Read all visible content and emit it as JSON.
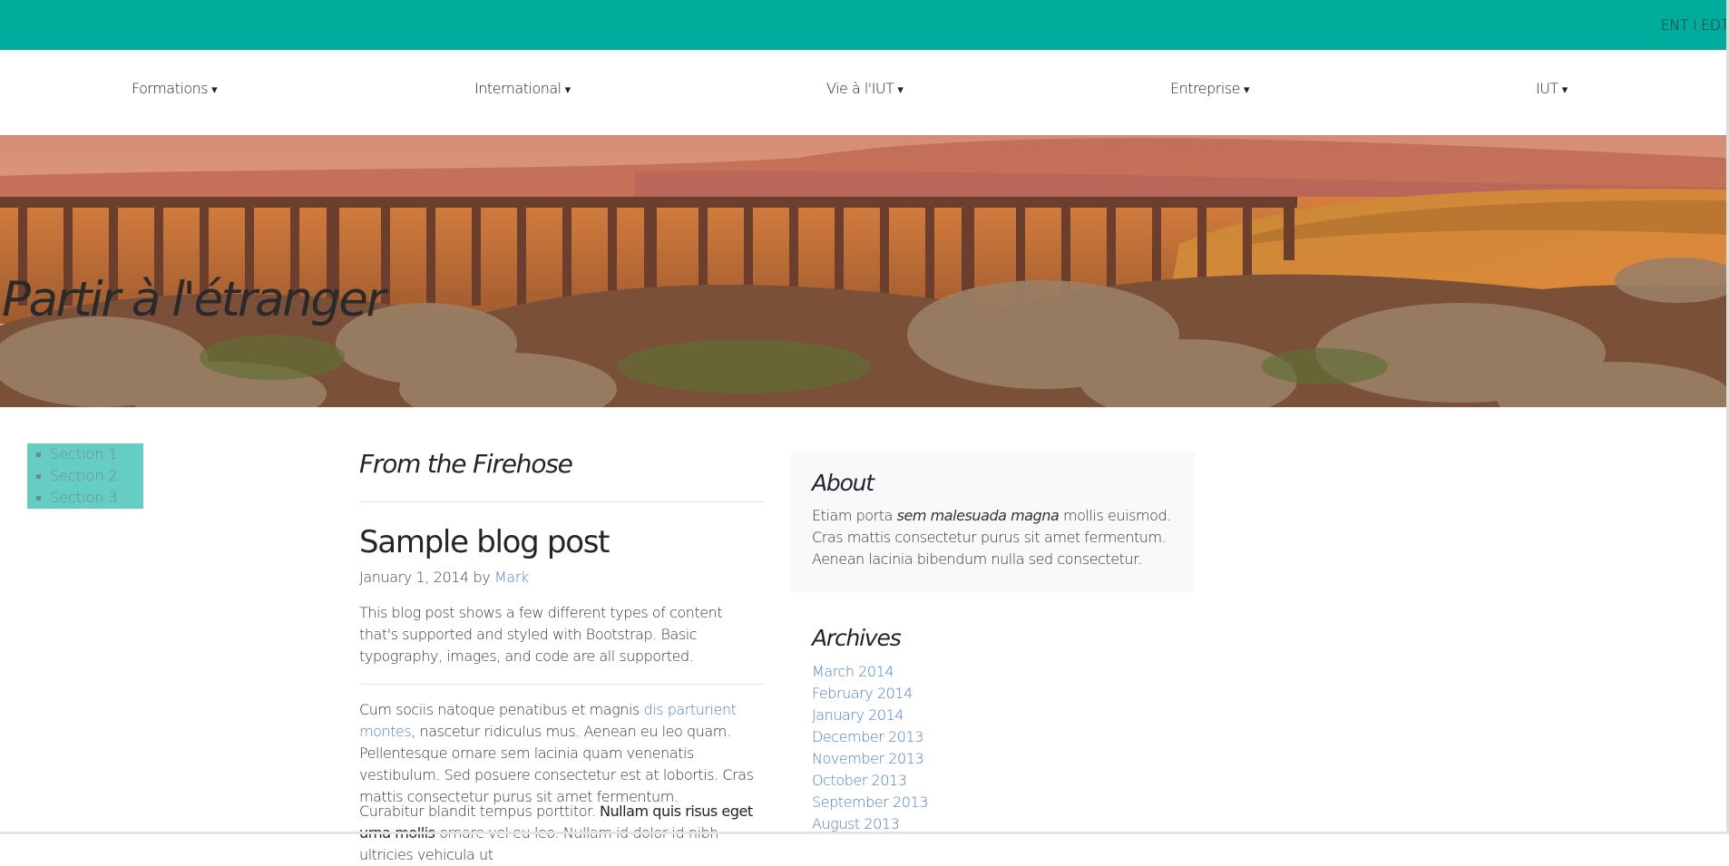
{
  "utility": {
    "links": [
      "ENT",
      "EDT"
    ],
    "separator": "I"
  },
  "nav": {
    "items": [
      {
        "label": "Formations",
        "caret": "▾"
      },
      {
        "label": "International",
        "caret": "▾"
      },
      {
        "label": "Vie à l'IUT",
        "caret": "▾"
      },
      {
        "label": "Entreprise",
        "caret": "▾"
      },
      {
        "label": "IUT",
        "caret": "▾"
      }
    ]
  },
  "hero": {
    "title": "Partir à l'étranger"
  },
  "section_nav": {
    "items": [
      "Section 1",
      "Section 2",
      "Section 3"
    ]
  },
  "main": {
    "heading": "From the Firehose",
    "post": {
      "title": "Sample blog post",
      "date": "January 1, 2014",
      "by": "by",
      "author": "Mark",
      "intro": "This blog post shows a few different types of content that's supported and styled with Bootstrap. Basic typography, images, and code are all supported.",
      "p1_before": "Cum sociis natoque penatibus et magnis ",
      "p1_link": "dis parturient montes",
      "p1_after": ", nascetur ridiculus mus. Aenean eu leo quam. Pellentesque ornare sem lacinia quam venenatis vestibulum. Sed posuere consectetur est at lobortis. Cras mattis consectetur purus sit amet fermentum.",
      "p2_before": "Curabitur blandit tempus porttitor. ",
      "p2_strong": "Nullam quis risus eget urna mollis",
      "p2_after": " ornare vel eu leo. Nullam id dolor id nibh ultricies vehicula ut"
    }
  },
  "sidebar": {
    "about": {
      "title": "About",
      "text_before": "Etiam porta ",
      "text_em": "sem malesuada magna",
      "text_after": " mollis euismod. Cras mattis consectetur purus sit amet fermentum. Aenean lacinia bibendum nulla sed consectetur."
    },
    "archives": {
      "title": "Archives",
      "items": [
        "March 2014",
        "February 2014",
        "January 2014",
        "December 2013",
        "November 2013",
        "October 2013",
        "September 2013",
        "August 2013"
      ]
    }
  },
  "colors": {
    "topbar": "#02ac9d",
    "section_nav_bg": "#66cdc4",
    "link": "#4a7fd4",
    "about_bg": "#f8f9fa"
  }
}
